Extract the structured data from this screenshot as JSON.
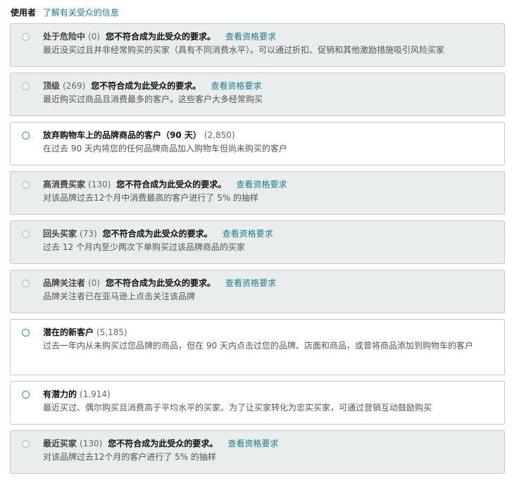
{
  "header": {
    "label": "使用者",
    "link": "了解有关受众的信息"
  },
  "options": [
    {
      "name": "处于危险中",
      "count": "(0)",
      "warning": "您不符合成为此受众的要求。",
      "requirement_link": "查看资格要求",
      "description": "最近没买过且并非经常购买的买家（具有不同消费水平）。可以通过折扣、促销和其他激励措施吸引风险买家",
      "eligible": false
    },
    {
      "name": "顶级",
      "count": "(269)",
      "warning": "您不符合成为此受众的要求。",
      "requirement_link": "查看资格要求",
      "description": "最近购买过商品且消费最多的客户。这些客户大多经常购买",
      "eligible": false
    },
    {
      "name": "放弃购物车上的品牌商品的客户（90 天）",
      "count": "(2,850)",
      "warning": "",
      "requirement_link": "",
      "description": "在过去 90 天内将您的任何品牌商品加入购物车但尚未购买的客户",
      "eligible": true
    },
    {
      "name": "高消费买家",
      "count": "(130)",
      "warning": "您不符合成为此受众的要求。",
      "requirement_link": "查看资格要求",
      "description": "对该品牌过去12个月中消费最高的客户进行了 5% 的抽样",
      "eligible": false
    },
    {
      "name": "回头买家",
      "count": "(73)",
      "warning": "您不符合成为此受众的要求。",
      "requirement_link": "查看资格要求",
      "description": "过去 12 个月内至少两次下单购买过该品牌商品的买家",
      "eligible": false
    },
    {
      "name": "品牌关注者",
      "count": "(0)",
      "warning": "您不符合成为此受众的要求。",
      "requirement_link": "查看资格要求",
      "description": "品牌关注者已在亚马逊上点击关注该品牌",
      "eligible": false
    },
    {
      "name": "潜在的新客户",
      "count": "(5,185)",
      "warning": "",
      "requirement_link": "",
      "description": "过去一年内从未购买过您品牌的商品，但在 90 天内点击过您的品牌、店面和商品，或曾将商品添加到购物车的客户",
      "eligible": true
    },
    {
      "name": "有潜力的",
      "count": "(1,914)",
      "warning": "",
      "requirement_link": "",
      "description": "最近买过、偶尔购买且消费高于平均水平的买家。为了让买家转化为忠实买家，可通过营销互动鼓励购买",
      "eligible": true
    },
    {
      "name": "最近买家",
      "count": "(130)",
      "warning": "您不符合成为此受众的要求。",
      "requirement_link": "查看资格要求",
      "description": "对该品牌过去12个月的客户进行了 5% 的抽样",
      "eligible": false
    }
  ]
}
